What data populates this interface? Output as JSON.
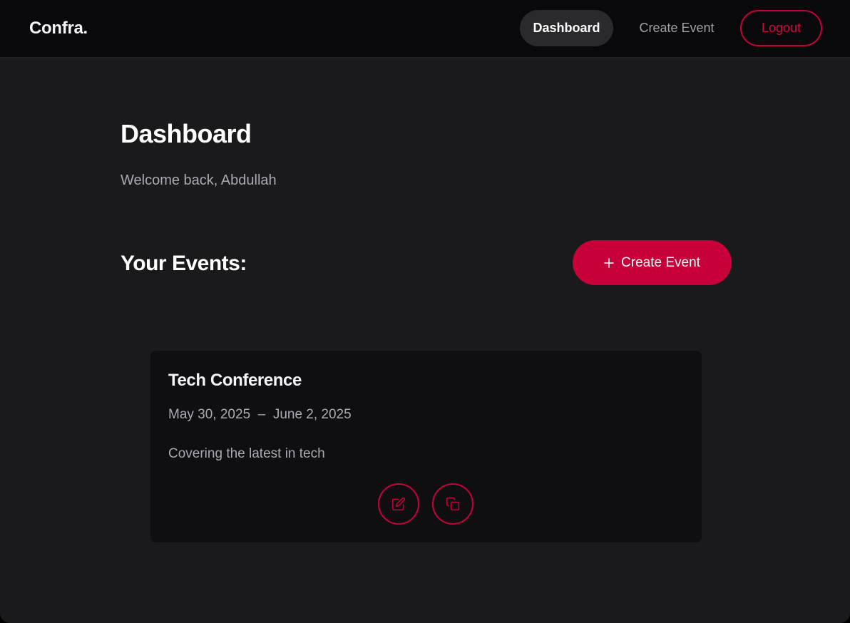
{
  "navbar": {
    "brand": "Confra.",
    "links": {
      "dashboard": "Dashboard",
      "create_event": "Create Event",
      "logout": "Logout"
    }
  },
  "main": {
    "title": "Dashboard",
    "welcome": "Welcome back, Abdullah",
    "section_title": "Your Events:",
    "create_button_label": "Create Event"
  },
  "events": [
    {
      "title": "Tech Conference",
      "dates": "May 30, 2025  –  June 2, 2025",
      "description": "Covering the latest in tech",
      "actions": [
        "edit-icon",
        "copy-icon"
      ]
    }
  ],
  "colors": {
    "accent": "#c8003a",
    "background": "#1a1a1c",
    "navbar_background": "#09090b",
    "card_background": "#0f0f11",
    "muted_text": "#a9a9b2"
  }
}
